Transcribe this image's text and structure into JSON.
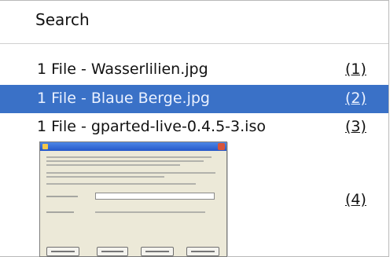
{
  "menu": {
    "title": "Search"
  },
  "items": [
    {
      "label": "1 File - Wasserlilien.jpg",
      "shortcut": "(1)",
      "selected": false
    },
    {
      "label": "1 File - Blaue Berge.jpg",
      "shortcut": "(2)",
      "selected": true
    },
    {
      "label": "1 File - gparted-live-0.4.5-3.iso",
      "shortcut": "(3)",
      "selected": false
    },
    {
      "label": "",
      "shortcut": "(4)",
      "selected": false
    }
  ],
  "colors": {
    "selection": "#3a71c7",
    "border": "#b9b9b9"
  },
  "icons": {
    "item4": "dialog-thumbnail"
  }
}
